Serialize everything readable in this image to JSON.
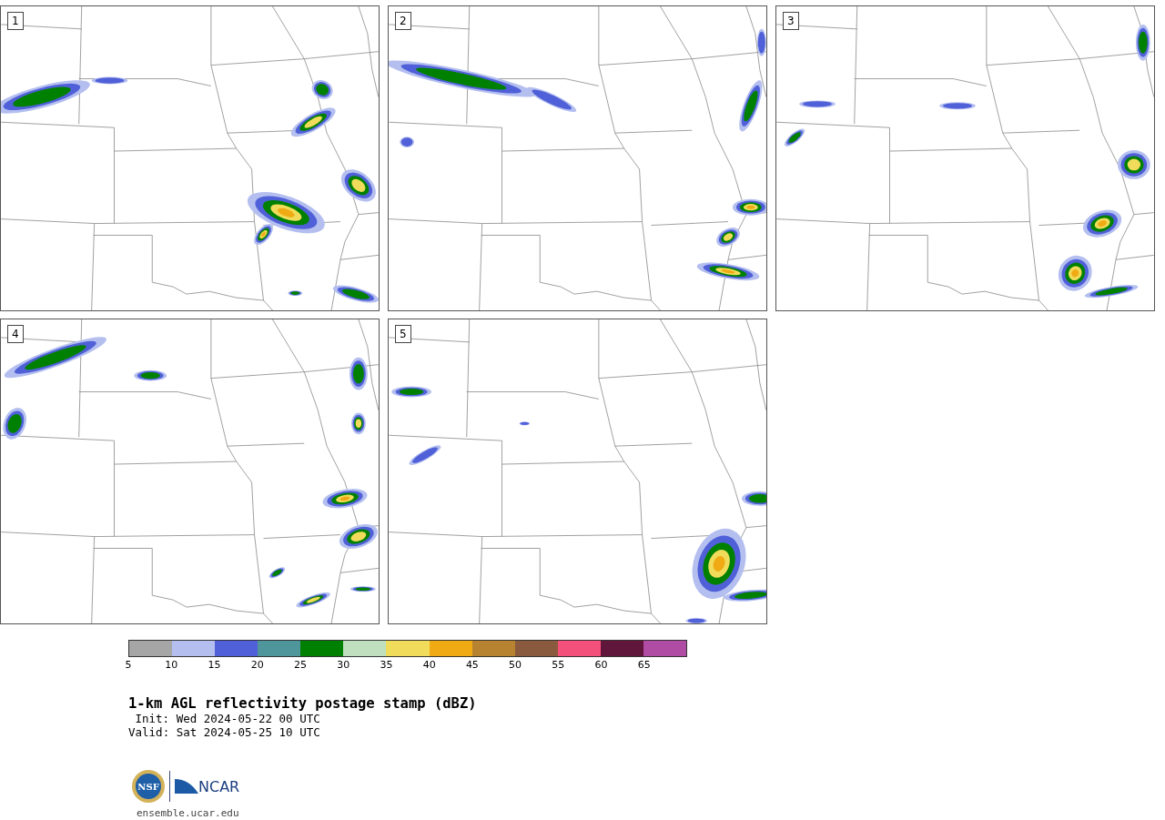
{
  "panels": [
    {
      "label": "1"
    },
    {
      "label": "2"
    },
    {
      "label": "3"
    },
    {
      "label": "4"
    },
    {
      "label": "5"
    }
  ],
  "colorbar": {
    "segments": [
      {
        "color": "#a6a6a6",
        "tick": "5"
      },
      {
        "color": "#b4bff0",
        "tick": "10"
      },
      {
        "color": "#5060d8",
        "tick": "15"
      },
      {
        "color": "#4f969c",
        "tick": "20"
      },
      {
        "color": "#008000",
        "tick": "25"
      },
      {
        "color": "#bfdfbf",
        "tick": "30"
      },
      {
        "color": "#f0dc5a",
        "tick": "35"
      },
      {
        "color": "#f0aa14",
        "tick": "40"
      },
      {
        "color": "#b88330",
        "tick": "45"
      },
      {
        "color": "#8a5a3f",
        "tick": "50"
      },
      {
        "color": "#f4507c",
        "tick": "55"
      },
      {
        "color": "#60163a",
        "tick": "60"
      },
      {
        "color": "#b04ca4",
        "tick": "65"
      }
    ]
  },
  "title": "1-km AGL reflectivity postage stamp (dBZ)",
  "init": "Init: Wed 2024-05-22 00 UTC",
  "valid": "Valid: Sat 2024-05-25 10 UTC",
  "logos": {
    "nsf": "NSF",
    "ncar": "NCAR"
  },
  "url": "ensemble.ucar.edu"
}
